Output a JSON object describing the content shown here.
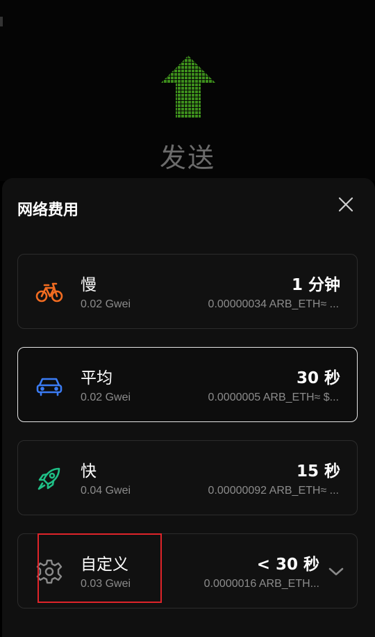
{
  "screen": {
    "title": "发送"
  },
  "sheet": {
    "title": "网络费用"
  },
  "options": [
    {
      "name": "慢",
      "gwei": "0.02 Gwei",
      "time": "1 分钟",
      "amount": "0.00000034 ARB_ETH≈ ...",
      "icon": "bicycle-icon",
      "color": "#f26c21"
    },
    {
      "name": "平均",
      "gwei": "0.02 Gwei",
      "time": "30 秒",
      "amount": "0.0000005 ARB_ETH≈ $...",
      "icon": "car-icon",
      "color": "#3b7cf5",
      "selected": true
    },
    {
      "name": "快",
      "gwei": "0.04 Gwei",
      "time": "15 秒",
      "amount": "0.00000092 ARB_ETH≈ ...",
      "icon": "rocket-icon",
      "color": "#1fbf86"
    },
    {
      "name": "自定义",
      "gwei": "0.03 Gwei",
      "time": "< 30 秒",
      "amount": "0.0000016 ARB_ETH...",
      "icon": "gear-icon",
      "color": "#8a8a8a"
    }
  ],
  "colors": {
    "arrow": "#3d8f1c",
    "highlight": "#e0242a",
    "selected_border": "#e6e6e6"
  }
}
